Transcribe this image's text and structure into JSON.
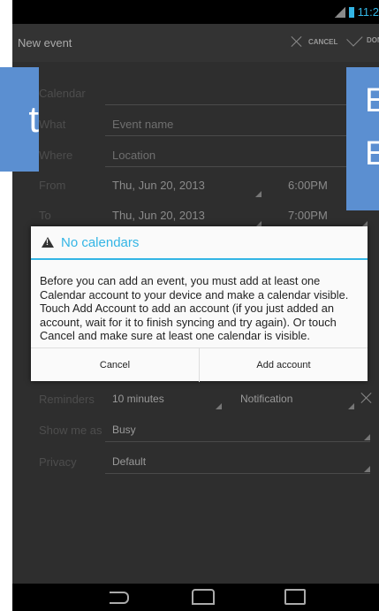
{
  "status_bar": {
    "time": "11:2"
  },
  "action_bar": {
    "title": "New event",
    "cancel_label": "CANCEL",
    "done_label": "DON"
  },
  "form": {
    "calendar_label": "Calendar",
    "what_label": "What",
    "what_placeholder": "Event name",
    "where_label": "Where",
    "where_placeholder": "Location",
    "from_label": "From",
    "from_date": "Thu, Jun 20, 2013",
    "from_time": "6:00PM",
    "to_label": "To",
    "to_date": "Thu, Jun 20, 2013",
    "to_time": "7:00PM",
    "reminders_label": "Reminders",
    "reminders_value": "10 minutes",
    "reminders_method": "Notification",
    "show_me_as_label": "Show me as",
    "show_me_as_value": "Busy",
    "privacy_label": "Privacy",
    "privacy_value": "Default"
  },
  "overlay": {
    "left_char": "t",
    "right_line1": "E",
    "right_line2": "E"
  },
  "dialog": {
    "title": "No calendars",
    "message": "Before you can add an event, you must add at least one Calendar account to your device and make a calendar visible. Touch Add Account to add an account (if you just added an account, wait for it to finish syncing and try again). Or touch Cancel and make sure at least one calendar is visible.",
    "cancel_label": "Cancel",
    "add_account_label": "Add account"
  },
  "nav_icons": [
    "back-icon",
    "home-icon",
    "recent-apps-icon"
  ],
  "colors": {
    "accent": "#33b5e5",
    "overlay_blue": "#5b8fd1"
  }
}
